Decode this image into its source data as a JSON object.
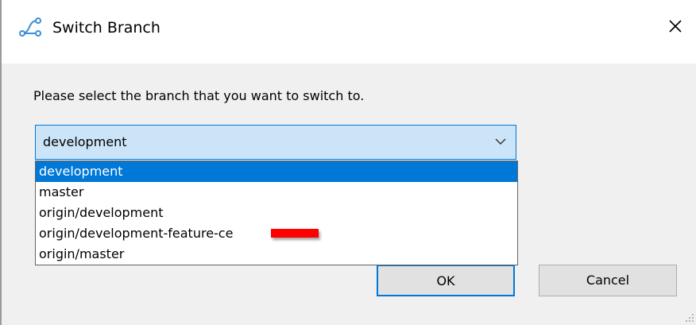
{
  "window": {
    "title": "Switch Branch",
    "icon": "branch-icon",
    "close_icon": "close-icon"
  },
  "dialog": {
    "prompt": "Please select the branch that you want to switch to.",
    "combo": {
      "selected": "development",
      "arrow_icon": "chevron-down-icon"
    },
    "options": [
      {
        "label": "development",
        "selected": true
      },
      {
        "label": "master",
        "selected": false
      },
      {
        "label": "origin/development",
        "selected": false
      },
      {
        "label": "origin/development-feature-ce",
        "selected": false,
        "redacted": true
      },
      {
        "label": "origin/master",
        "selected": false
      }
    ],
    "buttons": {
      "ok_label": "OK",
      "cancel_label": "Cancel"
    }
  },
  "colors": {
    "accent": "#0078d7",
    "combo_background": "#cce4f7",
    "client_background": "#f0f0f0",
    "redaction": "#ff0000"
  }
}
